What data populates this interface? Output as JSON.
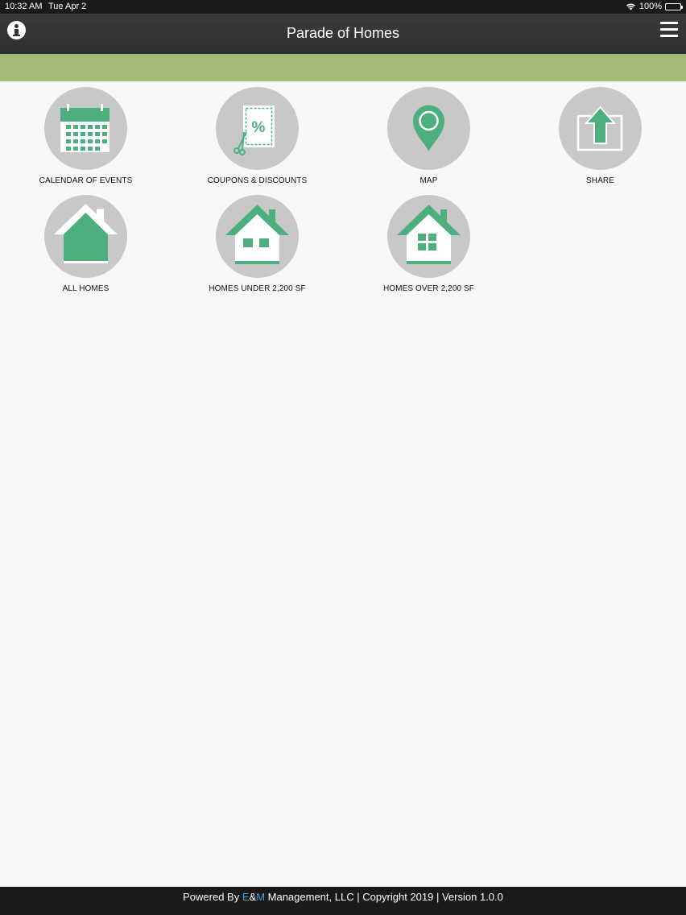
{
  "status_bar": {
    "time": "10:32 AM",
    "date": "Tue Apr 2",
    "battery": "100%",
    "battery_level": 1.0
  },
  "header": {
    "title": "Parade of Homes",
    "info_icon": "info-icon",
    "menu_icon": "hamburger-menu-icon"
  },
  "colors": {
    "accent_green": "#4caf7d",
    "header_band": "#a4bb78",
    "icon_circle": "#c8c8c8",
    "footer_link": "#3aa1e0"
  },
  "tiles": [
    {
      "label": "CALENDAR OF EVENTS",
      "icon": "calendar-icon"
    },
    {
      "label": "COUPONS & DISCOUNTS",
      "icon": "coupon-scissors-icon"
    },
    {
      "label": "MAP",
      "icon": "map-pin-icon"
    },
    {
      "label": "SHARE",
      "icon": "share-upload-icon"
    },
    {
      "label": "ALL HOMES",
      "icon": "house-icon"
    },
    {
      "label": "HOMES UNDER 2,200 SF",
      "icon": "small-house-icon"
    },
    {
      "label": "HOMES OVER 2,200 SF",
      "icon": "large-house-icon"
    }
  ],
  "footer": {
    "prefix": "Powered By ",
    "brand_e": "E",
    "brand_amp": "&",
    "brand_m": "M",
    "suffix": " Management, LLC | Copyright 2019 | Version 1.0.0"
  }
}
